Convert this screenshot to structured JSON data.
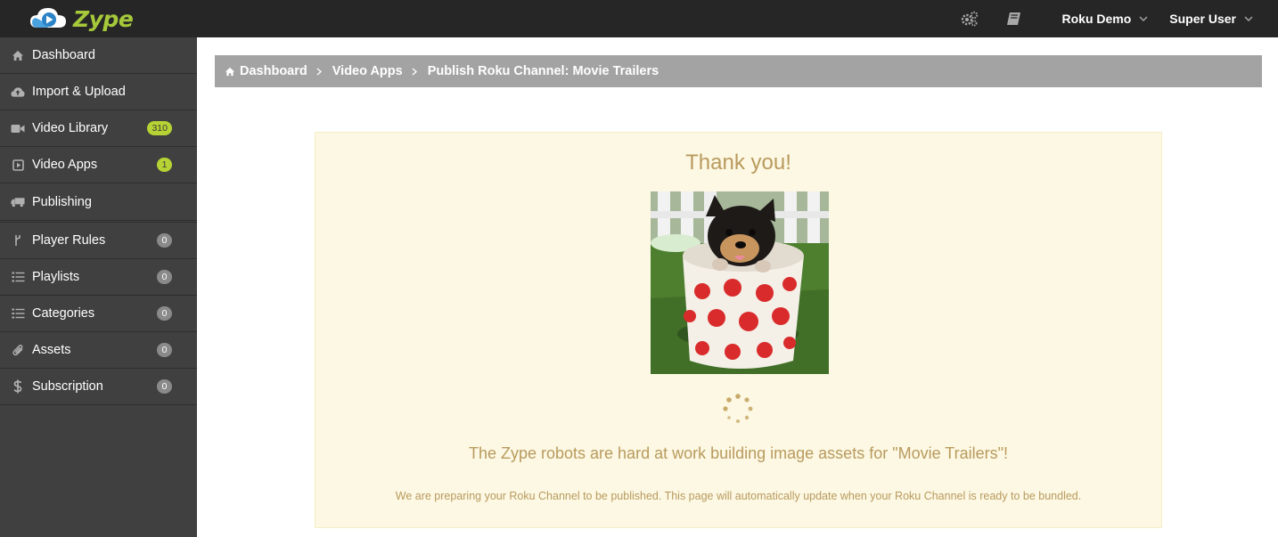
{
  "app": {
    "name": "Zype"
  },
  "topbar": {
    "account_label": "Roku Demo",
    "user_label": "Super User"
  },
  "sidebar": {
    "items": [
      {
        "label": "Dashboard",
        "icon": "home-icon"
      },
      {
        "label": "Import & Upload",
        "icon": "cloud-upload-icon"
      },
      {
        "label": "Video Library",
        "icon": "video-camera-icon",
        "badge": "310"
      },
      {
        "label": "Video Apps",
        "icon": "play-square-icon",
        "badge": "1"
      },
      {
        "label": "Publishing",
        "icon": "truck-icon"
      },
      {
        "label": "Player Rules",
        "icon": "code-fork-icon",
        "badge": "0"
      },
      {
        "label": "Playlists",
        "icon": "list-icon",
        "badge": "0"
      },
      {
        "label": "Categories",
        "icon": "list-icon",
        "badge": "0"
      },
      {
        "label": "Assets",
        "icon": "paperclip-icon",
        "badge": "0"
      },
      {
        "label": "Subscription",
        "icon": "dollar-icon",
        "badge": "0"
      }
    ]
  },
  "breadcrumb": {
    "items": [
      "Dashboard",
      "Video Apps",
      "Publish Roku Channel: Movie Trailers"
    ]
  },
  "main": {
    "heading": "Thank you!",
    "message": "The Zype robots are hard at work building image assets for \"Movie Trailers\"!",
    "sub_message": "We are preparing your Roku Channel to be published. This page will automatically update when your Roku Channel is ready to be bundled."
  },
  "colors": {
    "brand_green": "#a6c93a",
    "sidebar_bg": "#404040",
    "topbar_bg": "#262626",
    "alert_bg": "#fcf8e3",
    "alert_text": "#b99a5e"
  }
}
